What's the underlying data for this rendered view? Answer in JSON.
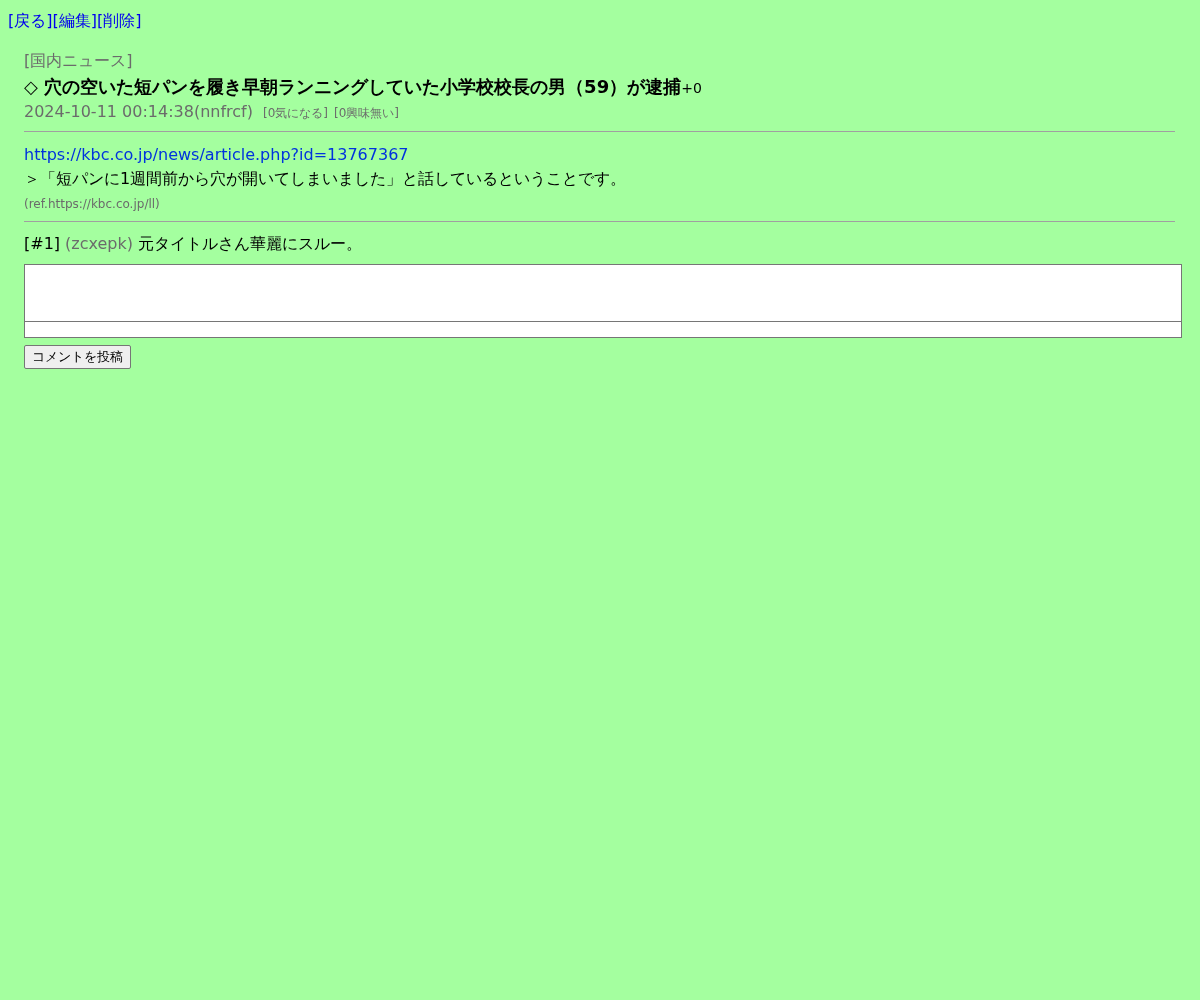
{
  "nav_links": [
    "[戻る]",
    "[編集]",
    "[削除]"
  ],
  "article": {
    "category": "[国内ニュース]",
    "title": "◇ 穴の空いた短パンを履き早朝ランニングしていた小学校校長の男（59）が逮捕",
    "score": "+0",
    "meta": "2024-10-11 00:14:38(nnfrcf)",
    "reactions": [
      "[0気になる]",
      "[0興味無い]"
    ],
    "link": "https://kbc.co.jp/news/article.php?id=13767367",
    "quote": "＞「短パンに1週間前から穴が開いてしまいました」と話しているということです。",
    "ref": "(ref.https://kbc.co.jp/ll)"
  },
  "comments": [
    {
      "number": "[#1]",
      "author": "(zcxepk)",
      "text": "元タイトルさん華麗にスルー。"
    }
  ],
  "post_button": "コメントを投稿"
}
